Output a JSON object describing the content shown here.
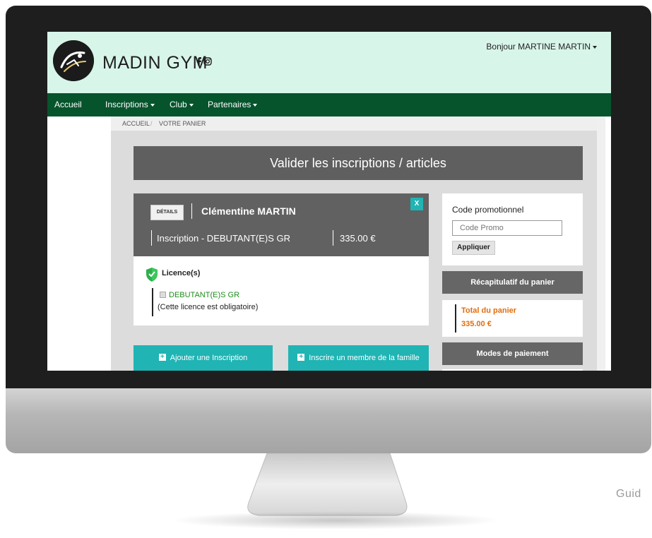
{
  "site": {
    "brand": "MADIN GYM",
    "greeting": "Bonjour MARTINE MARTIN",
    "social_icons": [
      "facebook-icon",
      "instagram-icon"
    ]
  },
  "nav": {
    "items": [
      {
        "label": "Accueil",
        "dropdown": false
      },
      {
        "label": "Inscriptions",
        "dropdown": true
      },
      {
        "label": "Club",
        "dropdown": true
      },
      {
        "label": "Partenaires",
        "dropdown": true
      }
    ]
  },
  "breadcrumb": {
    "home": "ACCUEIL",
    "separator": "/",
    "current": "VOTRE PANIER"
  },
  "page": {
    "title": "Valider les inscriptions / articles"
  },
  "cart_item": {
    "details_label": "DÉTAILS",
    "member_name": "Clémentine MARTIN",
    "close_label": "X",
    "line_label": "Inscription - DEBUTANT(E)S GR",
    "line_price": "335.00 €",
    "licences_title": "Licence(s)",
    "licence_name": "DEBUTANT(E)S GR",
    "licence_note": "(Cette licence est obligatoire)"
  },
  "actions": {
    "add_inscription": "Ajouter une Inscription",
    "add_family_member": "Inscrire un membre de la famille"
  },
  "promo": {
    "label": "Code promotionnel",
    "placeholder": "Code Promo",
    "apply_label": "Appliquer"
  },
  "summary": {
    "title": "Récapitulatif du panier",
    "total_label": "Total du panier",
    "total_value": "335.00 €"
  },
  "payment": {
    "title": "Modes de paiement"
  },
  "footer_text": "Guid",
  "colors": {
    "header_bg": "#d8f5ea",
    "nav_bg": "#06542c",
    "accent_teal": "#20b4b4",
    "panel_gray": "#616161",
    "total_orange": "#e36c0a",
    "licence_green": "#1e8c1e"
  }
}
